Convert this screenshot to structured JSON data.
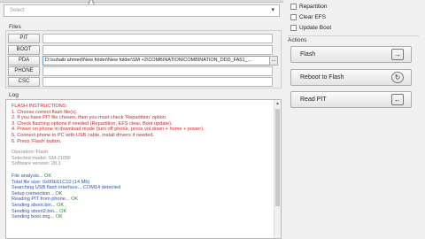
{
  "top": {
    "select_placeholder": "Select"
  },
  "options": [
    {
      "label": "Repartition"
    },
    {
      "label": "Clear EFS"
    },
    {
      "label": "Update Boot"
    }
  ],
  "actions_section": {
    "title": "Actions"
  },
  "actions": [
    {
      "label": "Flash"
    },
    {
      "label": "Reboot to Flash"
    },
    {
      "label": "Read PIT"
    }
  ],
  "files_section": {
    "title": "Files"
  },
  "files": [
    {
      "button": "PIT",
      "value": ""
    },
    {
      "button": "BOOT",
      "value": ""
    },
    {
      "button": "PDA",
      "value": "D:\\suhaib ahmed\\New folder\\New folder\\SM +2\\COMBINATION\\COMBINATION_DDD_FA51_...",
      "browse": "..."
    },
    {
      "button": "PHONE",
      "value": ""
    },
    {
      "button": "CSC",
      "value": ""
    }
  ],
  "log_section": {
    "title": "Log"
  },
  "log": {
    "instructions_title": "FLASH INSTRUCTIONS:",
    "instructions": [
      "1. Choose correct flash file(s).",
      "2. If you have PIT file chosen, then you must check 'Repartition' option.",
      "3. Check flashing options if needed (Repartition, EFS clear, Boot update).",
      "4. Power on phone in download mode (turn off phone, press vol.down + home + power).",
      "5. Connect phone to PC with USB cable, install drivers if needed.",
      "6. Press 'Flash' button."
    ],
    "info": [
      "Operation: Flash",
      "Selected model: SM-J105F",
      "Software version: 28.1"
    ],
    "entries": [
      {
        "text": "File analysis... ",
        "status": "OK"
      },
      {
        "text": "Total file size: 0x00E61C10 (14 Mb)",
        "status": ""
      },
      {
        "text": "Searching USB flash interface... ",
        "status": "COM14 detected"
      },
      {
        "text": "Setup connection... ",
        "status": "OK"
      },
      {
        "text": "Reading PIT from phone... ",
        "status": "OK"
      },
      {
        "text": "Sending sboot.bin... ",
        "status": "OK"
      },
      {
        "text": "Sending sboot2.bin... ",
        "status": "OK"
      },
      {
        "text": "Sending boot.img... ",
        "status": "OK"
      }
    ]
  }
}
